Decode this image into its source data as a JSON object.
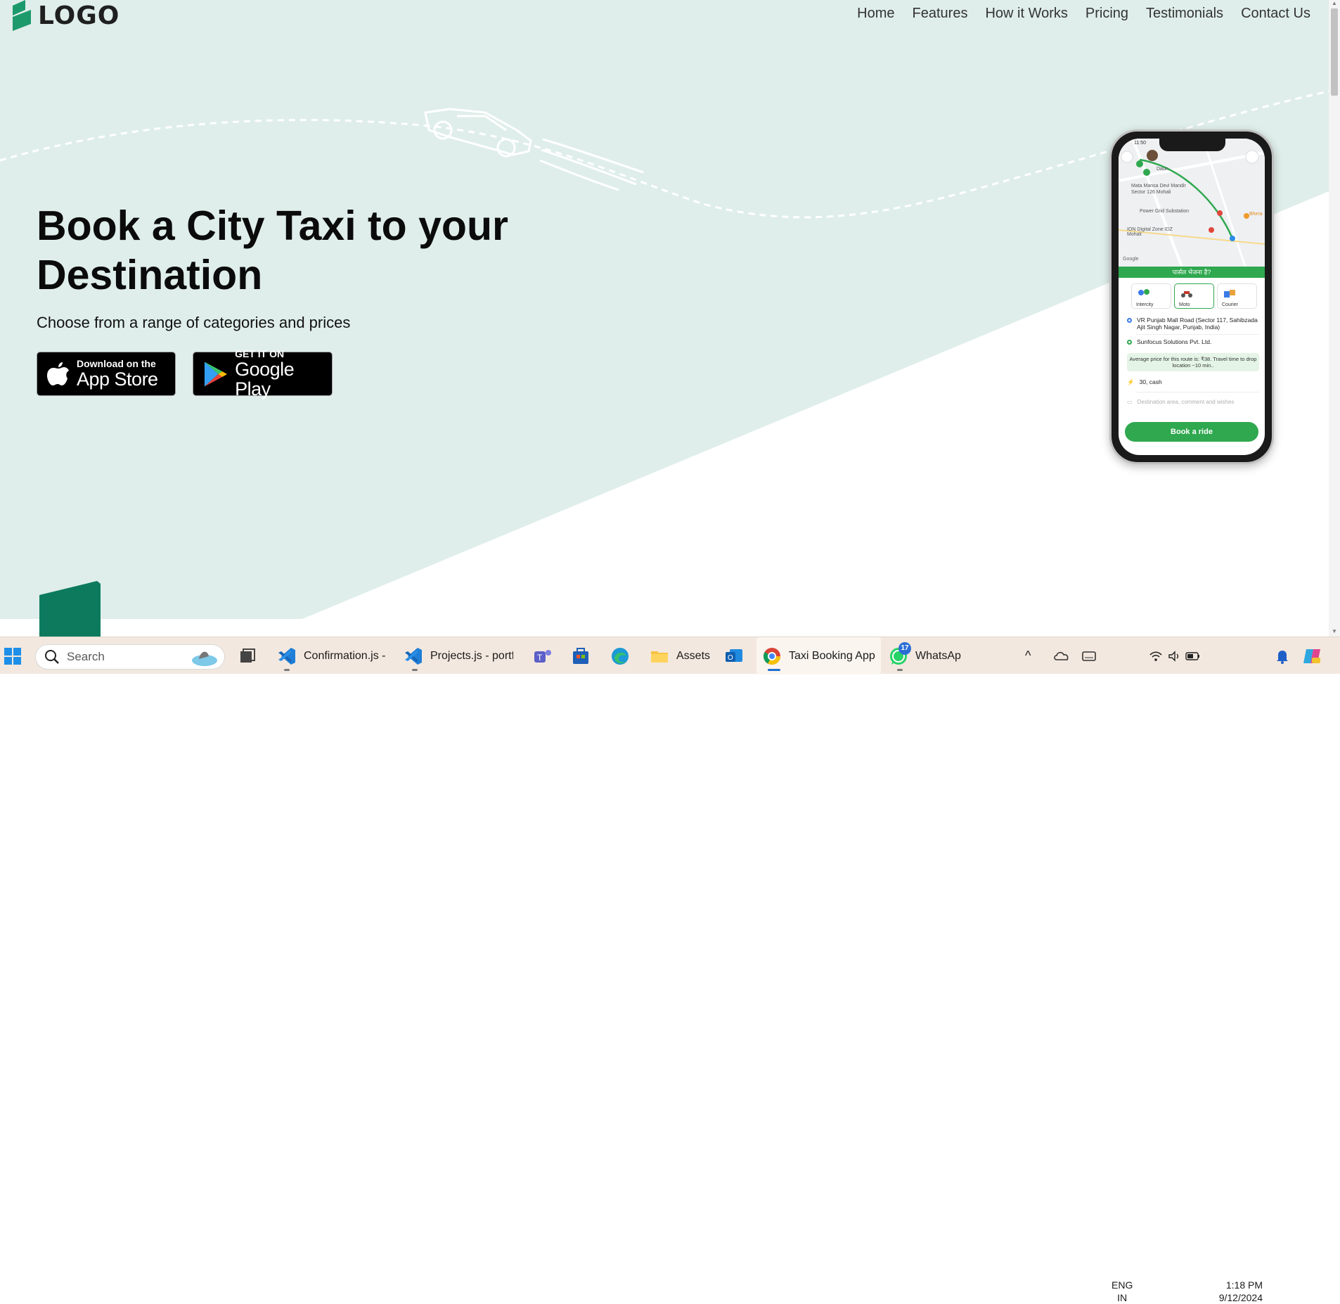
{
  "logo": {
    "text": "LOGO"
  },
  "nav": {
    "items": [
      "Home",
      "Features",
      "How it Works",
      "Pricing",
      "Testimonials",
      "Contact Us"
    ]
  },
  "hero": {
    "title_line1": "Book a City Taxi to your",
    "title_line2": "Destination",
    "subtitle": "Choose from a range of categories and prices",
    "app_store": {
      "small": "Download on the",
      "big": "App Store"
    },
    "google_play": {
      "small": "GET IT ON",
      "big": "Google Play"
    }
  },
  "phone": {
    "status_time": "11:50",
    "map_labels": [
      "Daun",
      "Mata Mansa Devi Mandir",
      "Sector 126 Mohali",
      "Power Grid Substation",
      "ION Digital Zone IDZ Mohali",
      "Bhera",
      "Google"
    ],
    "parcel_banner": "पार्सल भेजना है?",
    "categories": [
      {
        "label": "Intercity",
        "active": false
      },
      {
        "label": "Moto",
        "active": true
      },
      {
        "label": "Courier",
        "active": false
      }
    ],
    "pickup": "VR Punjab Mall Road (Sector 117, Sahibzada Ajit Singh Nagar, Punjab, India)",
    "dropoff": "Sunfocus Solutions Pvt. Ltd.",
    "price_note": "Average price for this route is: ₹38. Travel time to drop location ~10 min..",
    "payment": "30, cash",
    "comment_placeholder": "Destination area, comment and wishes",
    "book_button": "Book a ride"
  },
  "taskbar": {
    "search_placeholder": "Search",
    "apps": [
      {
        "label": "Confirmation.js -",
        "icon": "vscode-icon"
      },
      {
        "label": "Projects.js - portf",
        "icon": "vscode-icon"
      },
      {
        "label": "",
        "icon": "teams-icon"
      },
      {
        "label": "",
        "icon": "store-icon"
      },
      {
        "label": "",
        "icon": "edge-icon"
      },
      {
        "label": "Assets",
        "icon": "folder-icon"
      },
      {
        "label": "",
        "icon": "outlook-icon"
      },
      {
        "label": "Taxi Booking App",
        "icon": "chrome-icon"
      },
      {
        "label": "WhatsAp",
        "icon": "whatsapp-icon"
      }
    ],
    "whatsapp_badge": "17",
    "language": "ENG",
    "region": "IN",
    "time": "1:18 PM",
    "date": "9/12/2024"
  },
  "colors": {
    "hero_bg": "#dfeeea",
    "accent_green": "#2fa84f",
    "logo_green": "#1c9a6c",
    "block_green": "#0d7a5e"
  }
}
